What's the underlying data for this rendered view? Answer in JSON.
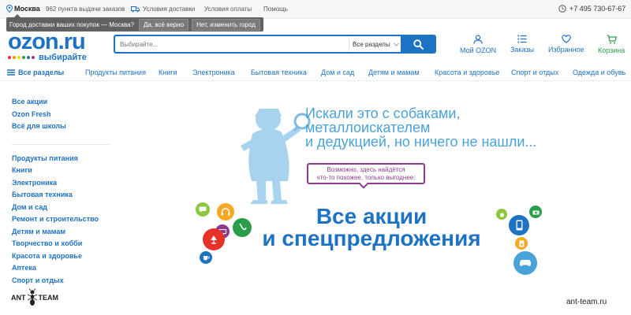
{
  "topbar": {
    "city": "Москва",
    "pickup_points": "962 пункта выдачи заказов",
    "delivery_terms": "Условия доставки",
    "payment_terms": "Условия оплаты",
    "help": "Помощь",
    "phone": "+7 495 730-67-67"
  },
  "city_prompt": {
    "question": "Город доставки ваших покупок — Москва?",
    "confirm": "Да, всё верно",
    "change": "Нет, изменить город"
  },
  "logo": {
    "word": "ozon",
    "tld": ".ru",
    "slogan": "выбирайте",
    "dot_colors": [
      "#e5332a",
      "#f39200",
      "#ffd400",
      "#2a9d4a",
      "#1d72c4",
      "#8e3b8e"
    ]
  },
  "search": {
    "placeholder": "Выбирайте...",
    "sections": "Все разделы"
  },
  "header": {
    "my_ozon": "Мой OZON",
    "orders": "Заказы",
    "favorites": "Избранное",
    "cart": "Корзина"
  },
  "catnav": {
    "all": "Все разделы",
    "items": [
      "Продукты питания",
      "Книги",
      "Электроника",
      "Бытовая техника",
      "Дом и сад",
      "Детям и мамам",
      "Красота и здоровье",
      "Спорт и отдых",
      "Одежда и обувь"
    ]
  },
  "sidebar": {
    "promo": [
      "Все акции",
      "Ozon Fresh",
      "Всё для школы"
    ],
    "items": [
      "Продукты питания",
      "Книги",
      "Электроника",
      "Бытовая техника",
      "Дом и сад",
      "Ремонт и строительство",
      "Детям и мамам",
      "Творчество и хобби",
      "Красота и здоровье",
      "Аптека",
      "Спорт и отдых"
    ]
  },
  "hero": {
    "tagline": [
      "Искали это с собаками,",
      "металлоискателем",
      "и дедукцией, но ничего не нашли..."
    ],
    "bubble": [
      "Возможно, здесь найдётся",
      "что-то похожее, только выгоднее:"
    ],
    "headline": [
      "Все акции",
      "и спецпредложения"
    ]
  },
  "watermark": {
    "brand_left": "ANT",
    "brand_right": "TEAM",
    "site": "ant-team.ru"
  },
  "colors": {
    "brand_blue": "#1d72c4",
    "cart_green": "#2a9d4a",
    "tagline_blue": "#4aa3d8",
    "bubble_purple": "#8e3b8e"
  }
}
